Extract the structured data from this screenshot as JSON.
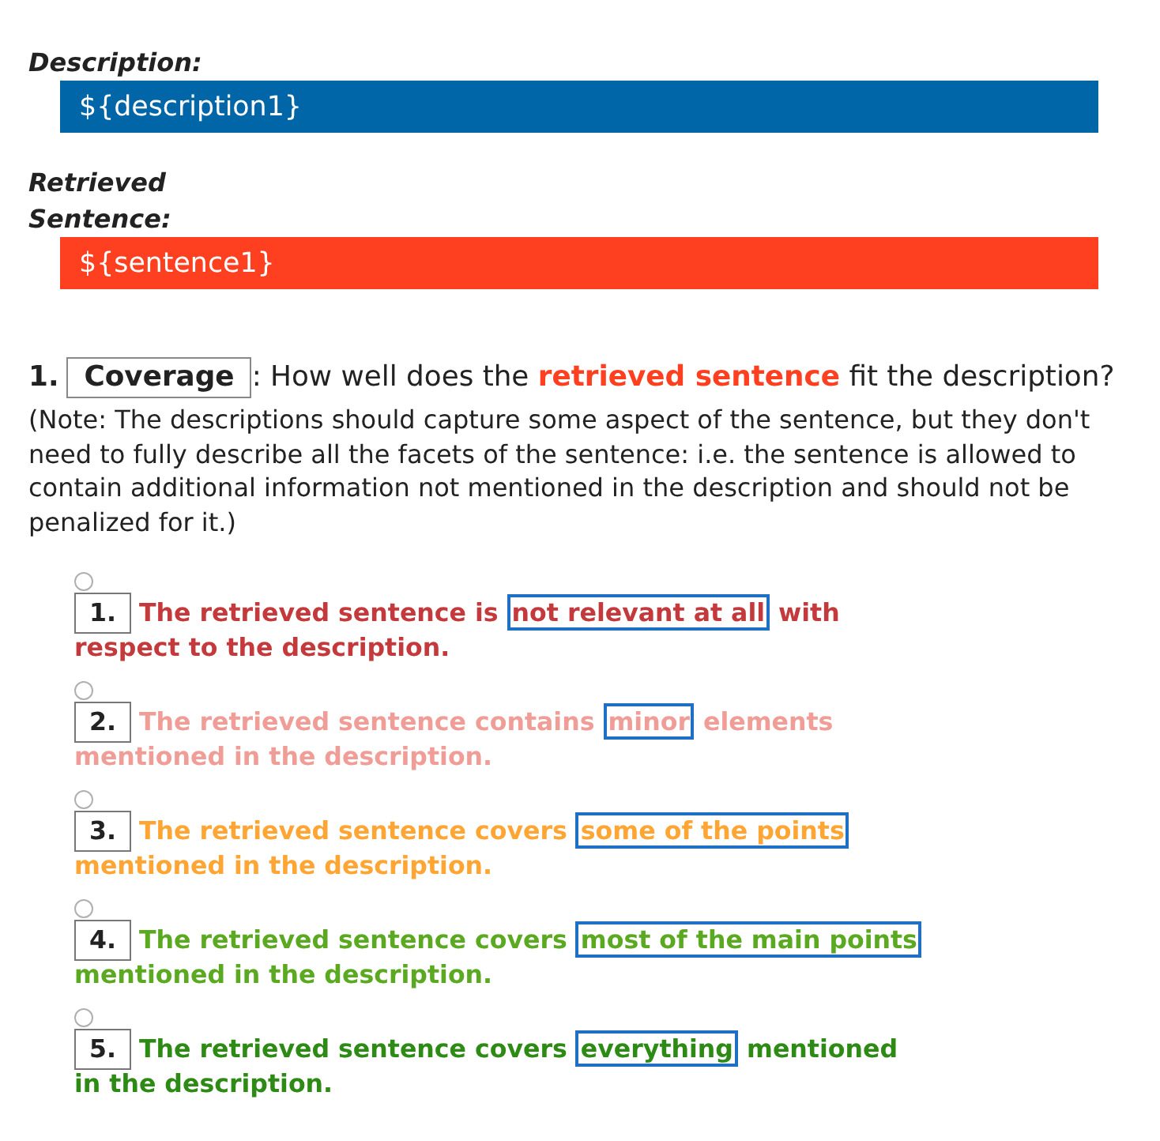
{
  "fields": [
    {
      "label": "Description:",
      "value": "${description1}",
      "color": "#0066a8"
    },
    {
      "label": "Retrieved Sentence:",
      "value": "${sentence1}",
      "color": "#ff4020"
    }
  ],
  "question": {
    "number": "1.",
    "title": "Coverage",
    "text": ": How well does the **retrieved sentence** fit the description?",
    "note": "(Note: The descriptions should capture some aspect of the sentence, but they don't need to fully describe all the facets of the sentence: i.e. the sentence is allowed to contain additional information not mentioned in the description and should not be penalized for it.)"
  },
  "options": [
    {
      "number": "1.",
      "text_before": "The retrieved sentence is",
      "highlight": "not relevant at all",
      "text_after": "with respect to the description.",
      "color": "#c4393b",
      "selected": false
    },
    {
      "number": "2.",
      "text_before": "The retrieved sentence contains",
      "highlight": "minor",
      "text_after": "elements mentioned in the description.",
      "color": "#ef9d96",
      "selected": false
    },
    {
      "number": "3.",
      "text_before": "The retrieved sentence covers",
      "highlight": "some of the points",
      "text_after": "mentioned in the description.",
      "color": "#ffa534",
      "selected": false
    },
    {
      "number": "4.",
      "text_before": "The retrieved sentence covers",
      "highlight": "most of the main points",
      "text_after": "mentioned in the description.",
      "color": "#5aa920",
      "selected": false
    },
    {
      "number": "5.",
      "text_before": "The retrieved sentence covers",
      "highlight": "everything",
      "text_after": "mentioned in the description.",
      "color": "#2d8a15",
      "selected": false
    }
  ]
}
